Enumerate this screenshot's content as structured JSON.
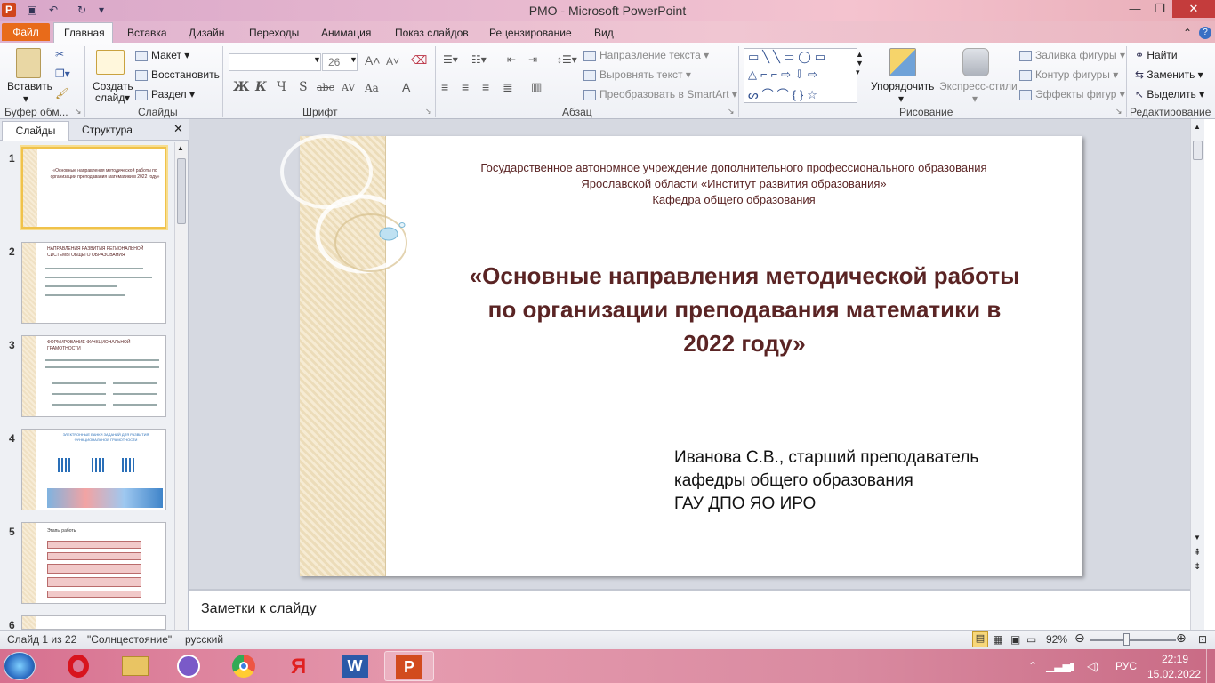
{
  "window": {
    "title": "РМО - Microsoft PowerPoint",
    "app_icon": "powerpoint-icon"
  },
  "quick_access": [
    "save-icon",
    "undo-icon",
    "redo-icon"
  ],
  "tabs": [
    {
      "label": "Файл",
      "active": false
    },
    {
      "label": "Главная",
      "active": true
    },
    {
      "label": "Вставка",
      "active": false
    },
    {
      "label": "Дизайн",
      "active": false
    },
    {
      "label": "Переходы",
      "active": false
    },
    {
      "label": "Анимация",
      "active": false
    },
    {
      "label": "Показ слайдов",
      "active": false
    },
    {
      "label": "Рецензирование",
      "active": false
    },
    {
      "label": "Вид",
      "active": false
    }
  ],
  "ribbon": {
    "clipboard": {
      "paste": "Вставить",
      "group": "Буфер обм..."
    },
    "slides": {
      "new_slide_1": "Создать",
      "new_slide_2": "слайд",
      "layout": "Макет",
      "reset": "Восстановить",
      "section": "Раздел",
      "group": "Слайды"
    },
    "font": {
      "size": "26",
      "group": "Шрифт",
      "bold": "Ж",
      "italic": "К",
      "underline": "Ч",
      "shadow": "S",
      "strike": "abc",
      "spacing": "AV",
      "case": "Aa",
      "color": "A"
    },
    "paragraph": {
      "text_direction": "Направление текста",
      "align_text": "Выровнять текст",
      "smartart": "Преобразовать в SmartArt",
      "group": "Абзац"
    },
    "drawing": {
      "arrange": "Упорядочить",
      "quick_styles": "Экспресс-стили",
      "fill": "Заливка фигуры",
      "outline": "Контур фигуры",
      "effects": "Эффекты фигур",
      "group": "Рисование"
    },
    "editing": {
      "find": "Найти",
      "replace": "Заменить",
      "select": "Выделить",
      "group": "Редактирование"
    }
  },
  "left_pane": {
    "tab_slides": "Слайды",
    "tab_outline": "Структура",
    "thumbnails": [
      {
        "num": "1",
        "selected": true,
        "title": "«Основные направления методической работы по организации преподавания математики в 2022 году»"
      },
      {
        "num": "2",
        "selected": false,
        "title": "НАПРАВЛЕНИЯ РАЗВИТИЯ РЕГИОНАЛЬНОЙ СИСТЕМЫ ОБЩЕГО ОБРАЗОВАНИЯ"
      },
      {
        "num": "3",
        "selected": false,
        "title": "ФОРМИРОВАНИЕ ФУНКЦИОНАЛЬНОЙ ГРАМОТНОСТИ"
      },
      {
        "num": "4",
        "selected": false,
        "title": "ЭЛЕКТРОННЫЕ БАНКИ ЗАДАНИЙ ДЛЯ РАЗВИТИЯ ФУНКЦИОНАЛЬНОЙ ГРАМОТНОСТИ"
      },
      {
        "num": "5",
        "selected": false,
        "title": "Этапы работы"
      },
      {
        "num": "6",
        "selected": false,
        "title": ""
      }
    ]
  },
  "slide": {
    "org_line1": "Государственное автономное учреждение дополнительного профессионального образования",
    "org_line2": "Ярославской области «Институт развития образования»",
    "org_line3": "Кафедра общего образования",
    "title_line1": "«Основные направления методической работы",
    "title_line2": "по организации преподавания математики в",
    "title_line3": "2022 году»",
    "author_line1": "Иванова С.В., старший преподаватель",
    "author_line2": "кафедры общего образования",
    "author_line3": "ГАУ ДПО ЯО ИРО",
    "title_color": "#5a2424"
  },
  "notes": {
    "placeholder": "Заметки к слайду"
  },
  "status": {
    "slide_counter": "Слайд 1 из 22",
    "theme": "\"Солнцестояние\"",
    "language": "русский",
    "zoom": "92%"
  },
  "taskbar": {
    "apps": [
      "windows-start-icon",
      "opera-icon",
      "explorer-icon",
      "viber-icon",
      "chrome-icon",
      "yandex-icon",
      "word-icon",
      "powerpoint-icon"
    ],
    "lang": "РУС",
    "time": "22:19",
    "date": "15.02.2022"
  }
}
